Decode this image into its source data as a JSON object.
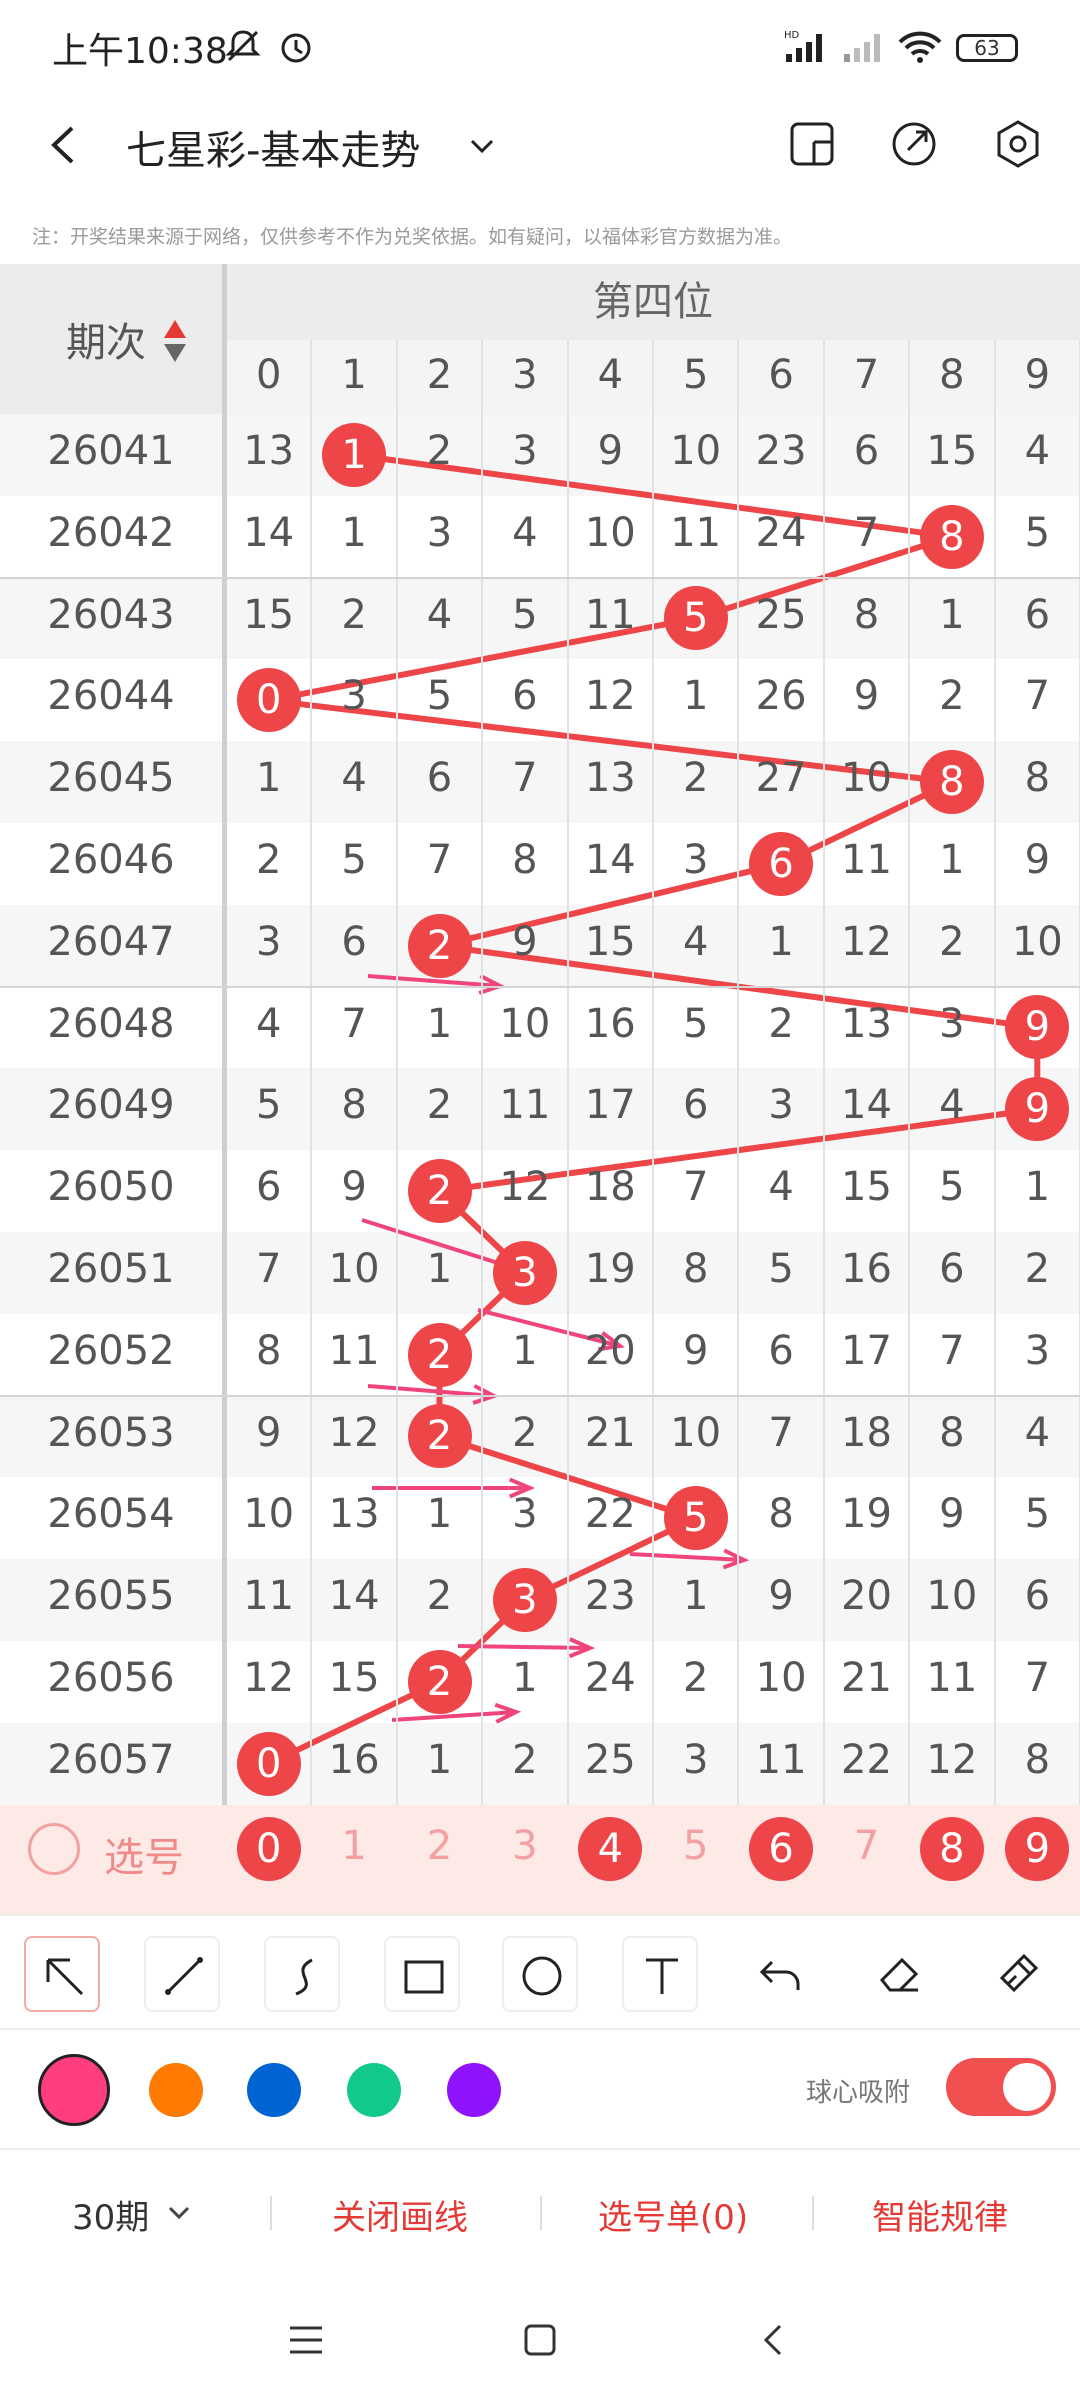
{
  "status": {
    "time": "上午10:38",
    "battery": "63"
  },
  "header": {
    "title": "七星彩-基本走势"
  },
  "note": "注：开奖结果来源于网络，仅供参考不作为兑奖依据。如有疑问，以福体彩官方数据为准。",
  "table": {
    "period_header": "期次",
    "group_header": "第四位",
    "digits": [
      "0",
      "1",
      "2",
      "3",
      "4",
      "5",
      "6",
      "7",
      "8",
      "9"
    ],
    "rows": [
      {
        "period": "26041",
        "cells": [
          "13",
          "1",
          "2",
          "3",
          "9",
          "10",
          "23",
          "6",
          "15",
          "4"
        ],
        "hit": 1
      },
      {
        "period": "26042",
        "cells": [
          "14",
          "1",
          "3",
          "4",
          "10",
          "11",
          "24",
          "7",
          "8",
          "5"
        ],
        "hit": 8
      },
      {
        "period": "26043",
        "cells": [
          "15",
          "2",
          "4",
          "5",
          "11",
          "5",
          "25",
          "8",
          "1",
          "6"
        ],
        "hit": 5
      },
      {
        "period": "26044",
        "cells": [
          "0",
          "3",
          "5",
          "6",
          "12",
          "1",
          "26",
          "9",
          "2",
          "7"
        ],
        "hit": 0
      },
      {
        "period": "26045",
        "cells": [
          "1",
          "4",
          "6",
          "7",
          "13",
          "2",
          "27",
          "10",
          "8",
          "8"
        ],
        "hit": 8
      },
      {
        "period": "26046",
        "cells": [
          "2",
          "5",
          "7",
          "8",
          "14",
          "3",
          "6",
          "11",
          "1",
          "9"
        ],
        "hit": 6
      },
      {
        "period": "26047",
        "cells": [
          "3",
          "6",
          "2",
          "9",
          "15",
          "4",
          "1",
          "12",
          "2",
          "10"
        ],
        "hit": 2
      },
      {
        "period": "26048",
        "cells": [
          "4",
          "7",
          "1",
          "10",
          "16",
          "5",
          "2",
          "13",
          "3",
          "9"
        ],
        "hit": 9
      },
      {
        "period": "26049",
        "cells": [
          "5",
          "8",
          "2",
          "11",
          "17",
          "6",
          "3",
          "14",
          "4",
          "9"
        ],
        "hit": 9
      },
      {
        "period": "26050",
        "cells": [
          "6",
          "9",
          "2",
          "12",
          "18",
          "7",
          "4",
          "15",
          "5",
          "1"
        ],
        "hit": 2
      },
      {
        "period": "26051",
        "cells": [
          "7",
          "10",
          "1",
          "3",
          "19",
          "8",
          "5",
          "16",
          "6",
          "2"
        ],
        "hit": 3
      },
      {
        "period": "26052",
        "cells": [
          "8",
          "11",
          "2",
          "1",
          "20",
          "9",
          "6",
          "17",
          "7",
          "3"
        ],
        "hit": 2
      },
      {
        "period": "26053",
        "cells": [
          "9",
          "12",
          "2",
          "2",
          "21",
          "10",
          "7",
          "18",
          "8",
          "4"
        ],
        "hit": 2
      },
      {
        "period": "26054",
        "cells": [
          "10",
          "13",
          "1",
          "3",
          "22",
          "5",
          "8",
          "19",
          "9",
          "5"
        ],
        "hit": 5
      },
      {
        "period": "26055",
        "cells": [
          "11",
          "14",
          "2",
          "3",
          "23",
          "1",
          "9",
          "20",
          "10",
          "6"
        ],
        "hit": 3
      },
      {
        "period": "26056",
        "cells": [
          "12",
          "15",
          "2",
          "1",
          "24",
          "2",
          "10",
          "21",
          "11",
          "7"
        ],
        "hit": 2
      },
      {
        "period": "26057",
        "cells": [
          "0",
          "16",
          "1",
          "2",
          "25",
          "3",
          "11",
          "22",
          "12",
          "8"
        ],
        "hit": 0
      }
    ],
    "select_label": "选号",
    "select_row": [
      "0",
      "1",
      "2",
      "3",
      "4",
      "5",
      "6",
      "7",
      "8",
      "9"
    ],
    "selected": [
      0,
      4,
      6,
      8,
      9
    ]
  },
  "toolbar": {
    "tools": [
      "arrow",
      "line",
      "curve",
      "rectangle",
      "circle",
      "text",
      "undo",
      "eraser",
      "clear"
    ]
  },
  "palette": {
    "colors": [
      "#ff3d7f",
      "#ff7a00",
      "#0064d2",
      "#10c98a",
      "#9013fe"
    ],
    "magnet_label": "球心吸附"
  },
  "bottom": {
    "periods": "30期",
    "close_lines": "关闭画线",
    "pick_list": "选号单(0)",
    "smart": "智能规律"
  }
}
